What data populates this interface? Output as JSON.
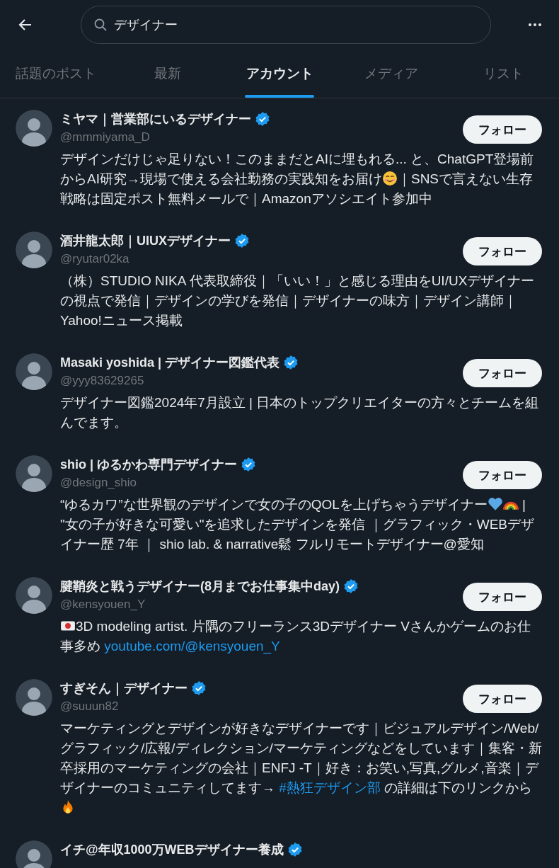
{
  "search": {
    "value": "デザイナー"
  },
  "tabs": [
    {
      "label": "話題のポスト",
      "selected": false
    },
    {
      "label": "最新",
      "selected": false
    },
    {
      "label": "アカウント",
      "selected": true
    },
    {
      "label": "メディア",
      "selected": false
    },
    {
      "label": "リスト",
      "selected": false
    }
  ],
  "accounts": [
    {
      "name": "ミヤマ｜営業部にいるデザイナー",
      "verified": true,
      "handle": "@mmmiyama_D",
      "follow": "フォロー",
      "bio": [
        {
          "kind": "text",
          "text": "デザインだけじゃ足りない！このままだとAIに埋もれる... と、ChatGPT登場前からAI研究→現場で使える会社勤務の実践知をお届け"
        },
        {
          "kind": "smiley"
        },
        {
          "kind": "text",
          "text": "｜SNSで言えない生存戦略は固定ポスト無料メールで｜Amazonアソシエイト参加中"
        }
      ]
    },
    {
      "name": "酒井龍太郎｜UIUXデザイナー",
      "verified": true,
      "handle": "@ryutar02ka",
      "follow": "フォロー",
      "bio": [
        {
          "kind": "text",
          "text": "（株）STUDIO NIKA 代表取締役｜「いい！」と感じる理由をUI/UXデザイナーの視点で発信｜デザインの学びを発信｜デザイナーの味方｜デザイン講師｜Yahoo!ニュース掲載"
        }
      ]
    },
    {
      "name": "Masaki yoshida | デザイナー図鑑代表",
      "verified": true,
      "handle": "@yyy83629265",
      "follow": "フォロー",
      "bio": [
        {
          "kind": "text",
          "text": "デザイナー図鑑2024年7月設立 | 日本のトップクリエイターの方々とチームを組んでます。"
        }
      ]
    },
    {
      "name": "shio | ゆるかわ専門デザイナー",
      "verified": true,
      "handle": "@design_shio",
      "follow": "フォロー",
      "bio": [
        {
          "kind": "text",
          "text": "“ゆるカワ”な世界観のデザインで女の子のQOLを上げちゃうデザイナー"
        },
        {
          "kind": "heart"
        },
        {
          "kind": "rainbow"
        },
        {
          "kind": "text",
          "text": " | \"女の子が好きな可愛い\"を追求したデザインを発信 ｜グラフィック・WEBデザイナー歴 7年 ｜ shio lab. & narrative鬆 フルリモートデザイナー@愛知"
        }
      ]
    },
    {
      "name": "腱鞘炎と戦うデザイナー(8月までお仕事集中day)",
      "verified": true,
      "handle": "@kensyouen_Y",
      "follow": "フォロー",
      "bio": [
        {
          "kind": "flag"
        },
        {
          "kind": "text",
          "text": "3D modeling artist. 片隅のフリーランス3Dデザイナー Vさんかゲームのお仕事多め "
        },
        {
          "kind": "link",
          "text": "youtube.com/@kensyouen_Y"
        }
      ]
    },
    {
      "name": "すぎそん｜デザイナー",
      "verified": true,
      "handle": "@suuun82",
      "follow": "フォロー",
      "bio": [
        {
          "kind": "text",
          "text": "マーケティングとデザインが好きなデザイナーです｜ビジュアルデザイン/Web/グラフィック/広報/ディレクション/マーケティングなどをしています｜集客・新卒採用のマーケティングの会社｜ENFJ -T｜好き：お笑い,写真,グルメ,音楽｜デザイナーのコミュニティしてます→ "
        },
        {
          "kind": "link",
          "text": "#熱狂デザイン部"
        },
        {
          "kind": "text",
          "text": " の詳細は下のリンクから"
        },
        {
          "kind": "fire"
        }
      ]
    },
    {
      "name": "イチ@年収1000万WEBデザイナー養成",
      "verified": true
    }
  ]
}
